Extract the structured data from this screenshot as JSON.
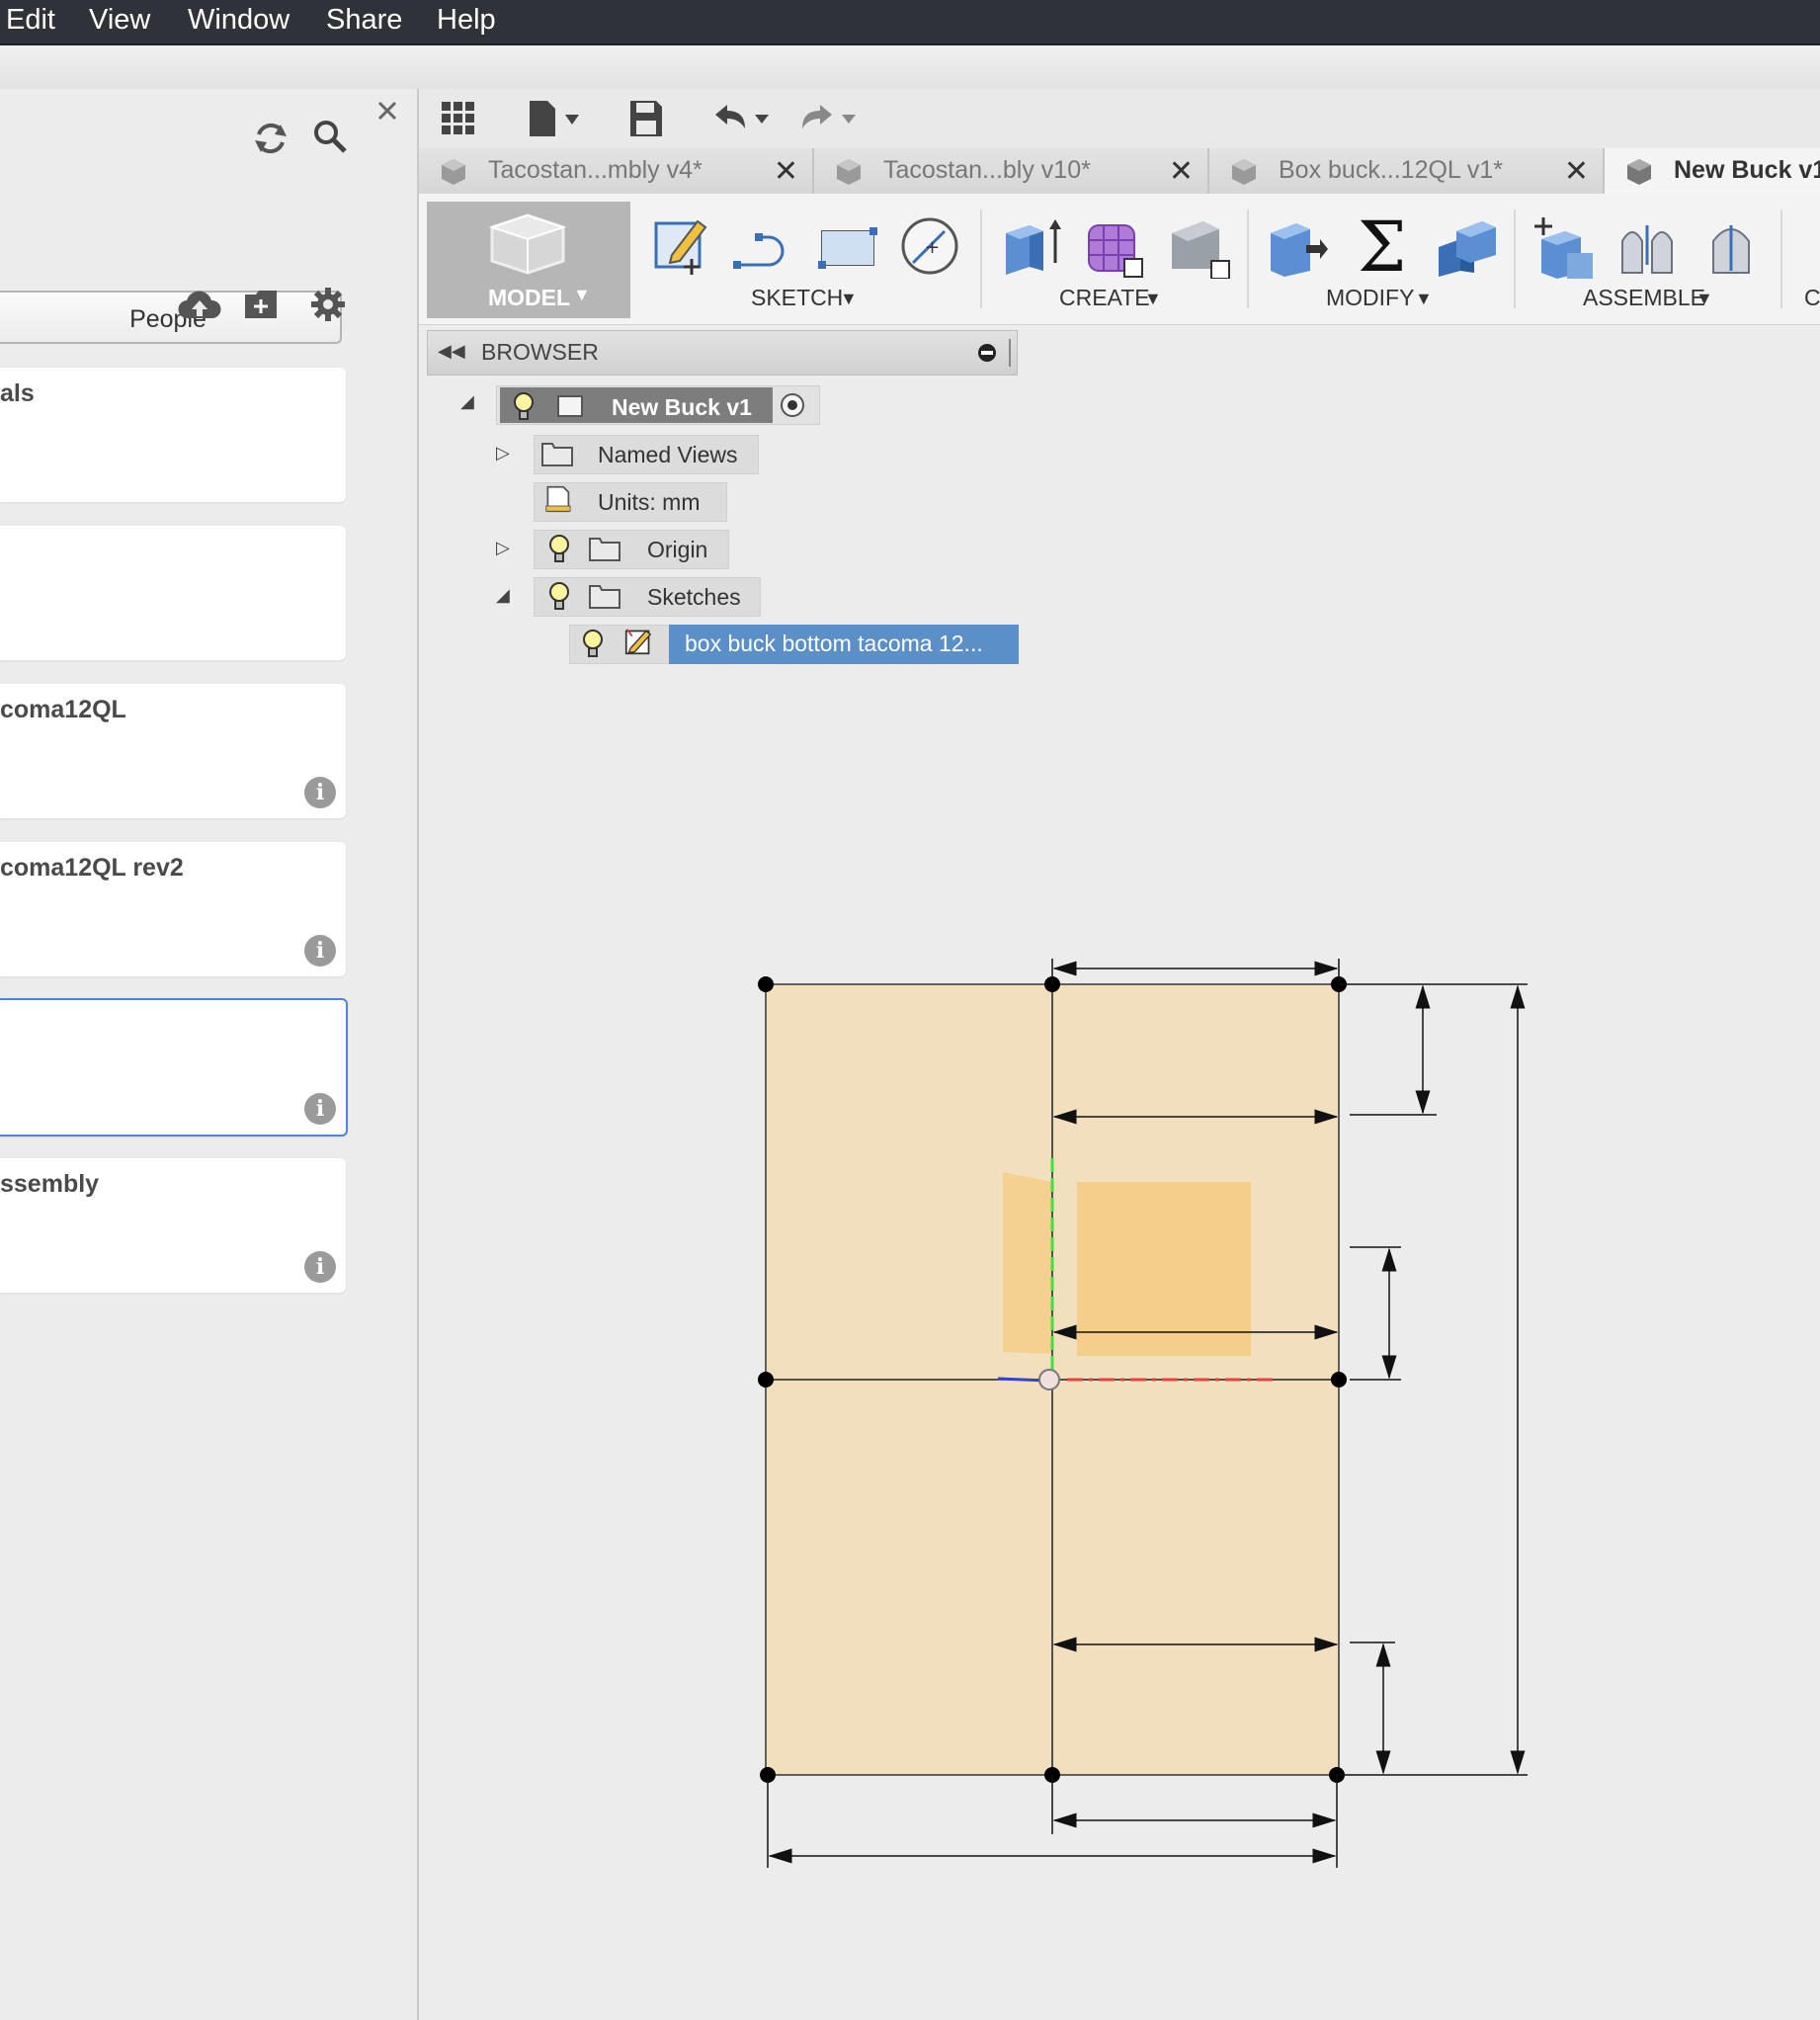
{
  "menu": [
    "Edit",
    "View",
    "Window",
    "Share",
    "Help"
  ],
  "left_panel": {
    "people_label": "People",
    "cards": [
      {
        "title": "als",
        "has_info": false
      },
      {
        "title": "",
        "has_info": false
      },
      {
        "title": "coma12QL",
        "has_info": true
      },
      {
        "title": "coma12QL rev2",
        "has_info": true
      },
      {
        "title": "",
        "has_info": true,
        "selected": true
      },
      {
        "title": "ssembly",
        "has_info": true
      }
    ],
    "info_glyph": "i"
  },
  "tabs": [
    {
      "label": "Tacostan...mbly v4*",
      "active": false
    },
    {
      "label": "Tacostan...bly v10*",
      "active": false
    },
    {
      "label": "Box buck...12QL v1*",
      "active": false
    },
    {
      "label": "New Buck v1",
      "active": true
    }
  ],
  "ribbon": {
    "model": "MODEL",
    "groups": [
      "SKETCH",
      "CREATE",
      "MODIFY",
      "ASSEMBLE",
      "C"
    ]
  },
  "browser": {
    "title": "BROWSER",
    "root": "New Buck v1",
    "items": [
      "Named Views",
      "Units: mm",
      "Origin",
      "Sketches"
    ],
    "sketch": "box buck bottom tacoma 12..."
  },
  "colors": {
    "menubar": "#2f3238",
    "selection": "#5b8fc8",
    "sketch_fill": "#f2dfbd",
    "profile_fill": "#f5cf8a"
  }
}
